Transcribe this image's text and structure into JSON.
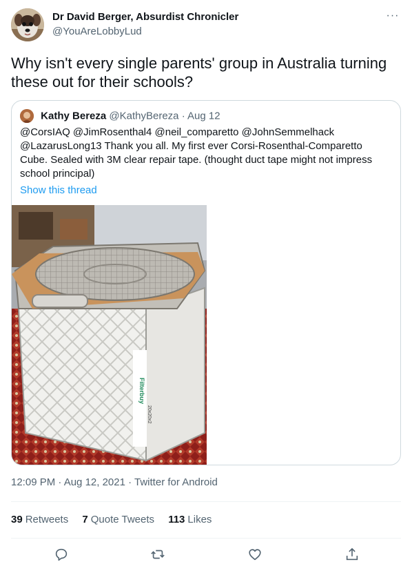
{
  "author": {
    "name": "Dr David Berger, Absurdist Chronicler",
    "handle": "@YouAreLobbyLud",
    "avatar_icon": "dog-avatar"
  },
  "more_label": "···",
  "tweet": {
    "text": "Why isn't every single parents' group in Australia turning these out for their schools?"
  },
  "quoted": {
    "name": "Kathy Bereza",
    "handle": "@KathyBereza",
    "date": "· Aug 12",
    "text": "@CorsIAQ @JimRosenthal4 @neil_comparetto @JohnSemmelhack @LazarusLong13 Thank you all. My first ever Corsi-Rosenthal-Comparetto Cube. Sealed with 3M clear repair tape. (thought duct tape might not impress school principal)",
    "thread_link": "Show this thread",
    "image_subject": "box-fan-air-filter-cube",
    "image_text": [
      "Filterbuy",
      "20x20x2"
    ]
  },
  "meta": {
    "timestamp": "12:09 PM · Aug 12, 2021 · Twitter for Android"
  },
  "stats": [
    {
      "value": "39",
      "label": "Retweets"
    },
    {
      "value": "7",
      "label": "Quote Tweets"
    },
    {
      "value": "113",
      "label": "Likes"
    }
  ],
  "actions": [
    {
      "icon": "reply-icon"
    },
    {
      "icon": "retweet-icon"
    },
    {
      "icon": "like-icon"
    },
    {
      "icon": "share-icon"
    }
  ],
  "colors": {
    "link": "#1d9bf0",
    "secondary_text": "#536471",
    "border": "#cfd9de"
  }
}
